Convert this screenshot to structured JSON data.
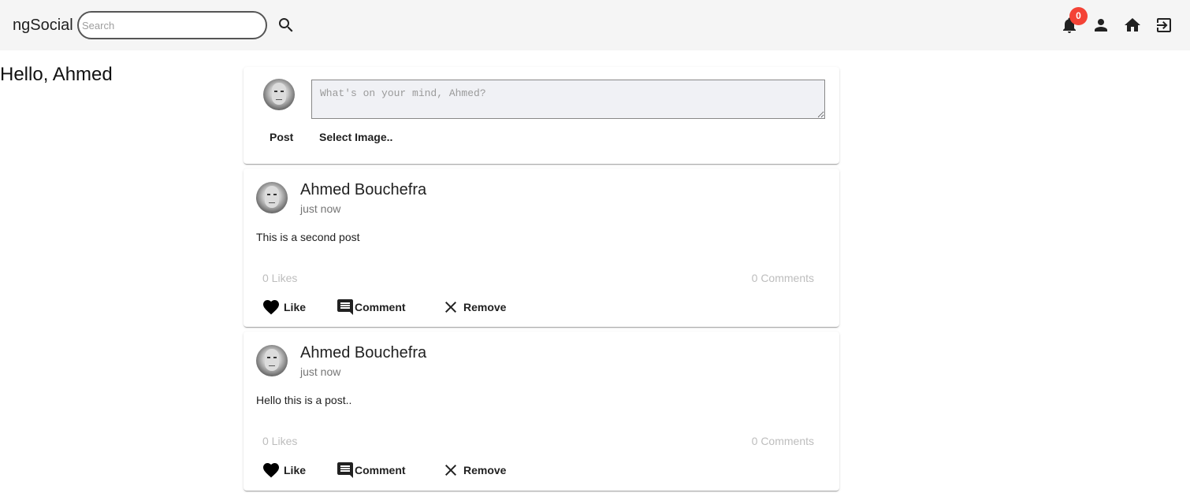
{
  "header": {
    "brand": "ngSocial",
    "search_placeholder": "Search",
    "notification_count": "0",
    "icons": [
      "search-icon",
      "bell-icon",
      "person-icon",
      "home-icon",
      "logout-icon"
    ]
  },
  "greeting": "Hello, Ahmed",
  "composer": {
    "placeholder": "What's on your mind, Ahmed?",
    "post_label": "Post",
    "select_image_label": "Select Image.."
  },
  "posts": [
    {
      "author": "Ahmed Bouchefra",
      "time": "just now",
      "text": "This is a second post",
      "likes": "0 Likes",
      "comments": "0 Comments",
      "like_label": "Like",
      "comment_label": "Comment",
      "remove_label": "Remove"
    },
    {
      "author": "Ahmed Bouchefra",
      "time": "just now",
      "text": "Hello this is a post..",
      "likes": "0 Likes",
      "comments": "0 Comments",
      "like_label": "Like",
      "comment_label": "Comment",
      "remove_label": "Remove"
    }
  ],
  "colors": {
    "toolbar_bg": "#f5f5f5",
    "badge": "#f44336",
    "muted_text": "#bdbdbd",
    "composer_bg": "#f0f1f5"
  }
}
